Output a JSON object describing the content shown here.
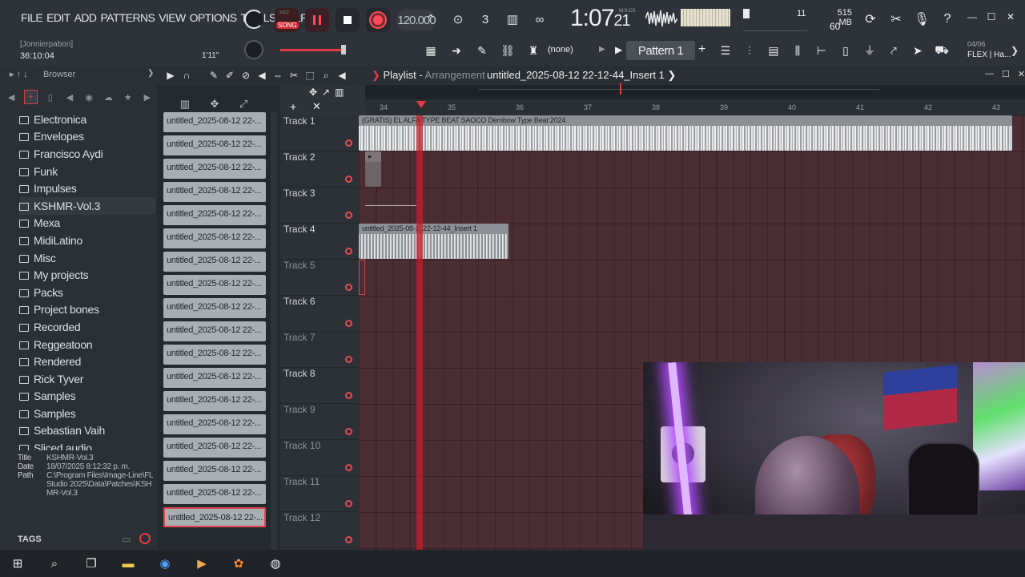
{
  "menu": [
    "FILE",
    "EDIT",
    "ADD",
    "PATTERNS",
    "VIEW",
    "OPTIONS",
    "TOOLS",
    "HELP"
  ],
  "hint": {
    "user": "[Jonnierpabon]",
    "time": "36:10:04"
  },
  "transport": {
    "pat_label": "PAT",
    "song_label": "SONG",
    "tempo": "120.000",
    "time_main": "1:07",
    "time_small": "21",
    "time_unit": "M:S:CS",
    "main_pitch": "1'11\""
  },
  "system": {
    "cpu_value": "11",
    "memory": "515 MB",
    "polyphony": "60"
  },
  "pattern_selector": {
    "channel": "(none)",
    "pattern": "Pattern 1"
  },
  "flex": {
    "date": "04/06",
    "name": "FLEX | Ha..."
  },
  "browser": {
    "title": "Browser",
    "folders": [
      "Electronica",
      "Envelopes",
      "Francisco Aydi",
      "Funk",
      "Impulses",
      "KSHMR-Vol.3",
      "Mexa",
      "MidiLatino",
      "Misc",
      "My projects",
      "Packs",
      "Project bones",
      "Recorded",
      "Reggeatoon",
      "Rendered",
      "Rick Tyver",
      "Samples",
      "Samples",
      "Sebastian Vaih",
      "Sliced audio"
    ],
    "selected_index": 5,
    "info": {
      "title_k": "Title",
      "title_v": "KSHMR-Vol.3",
      "date_k": "Date",
      "date_v": "18/07/2025 8:12:32 p. m.",
      "path_k": "Path",
      "path_v": "C:\\Program Files\\Image-Line\\FL Studio 2025\\Data\\Patches\\KSHMR-Vol.3"
    },
    "tags_label": "TAGS"
  },
  "playlist": {
    "title": "Playlist",
    "title_sub": "Arrangement",
    "file": "untitled_2025-08-12 22-12-44_Insert 1"
  },
  "pattern_clips": [
    "untitled_2025-08-12 22-...",
    "untitled_2025-08-12 22-...",
    "untitled_2025-08-12 22-...",
    "untitled_2025-08-12 22-...",
    "untitled_2025-08-12 22-...",
    "untitled_2025-08-12 22-...",
    "untitled_2025-08-12 22-...",
    "untitled_2025-08-12 22-...",
    "untitled_2025-08-12 22-...",
    "untitled_2025-08-12 22-...",
    "untitled_2025-08-12 22-...",
    "untitled_2025-08-12 22-...",
    "untitled_2025-08-12 22-...",
    "untitled_2025-08-12 22-...",
    "untitled_2025-08-12 22-...",
    "untitled_2025-08-12 22-...",
    "untitled_2025-08-12 22-...",
    "untitled_2025-08-12 22-..."
  ],
  "ruler_ticks": [
    "34",
    "35",
    "36",
    "37",
    "38",
    "39",
    "40",
    "41",
    "42",
    "43"
  ],
  "tracks": [
    "Track 1",
    "Track 2",
    "Track 3",
    "Track 4",
    "Track 5",
    "Track 6",
    "Track 7",
    "Track 8",
    "Track 9",
    "Track 10",
    "Track 11",
    "Track 12"
  ],
  "dim_tracks": [
    4,
    6,
    8,
    9,
    10,
    11
  ],
  "clips": {
    "track1": "(GRATIS) EL ALFA TYPE BEAT  SAOCO  Dembow Type Beat 2024",
    "track4": "untitled_2025-08-1..22-12-44_Insert 1"
  },
  "colors": {
    "accent": "#e23b45",
    "playlist_bg": "#4a2e33",
    "clip": "#9c9ea1"
  }
}
